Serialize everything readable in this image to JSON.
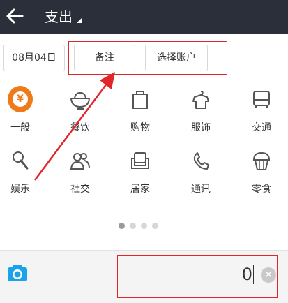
{
  "header": {
    "title": "支出"
  },
  "toolbar": {
    "date": "08月04日",
    "note": "备注",
    "account": "选择账户"
  },
  "categories": [
    {
      "label": "一般",
      "icon": "yen-circle-icon"
    },
    {
      "label": "餐饮",
      "icon": "rice-bowl-icon"
    },
    {
      "label": "购物",
      "icon": "shopping-bag-icon"
    },
    {
      "label": "服饰",
      "icon": "shirt-hanger-icon"
    },
    {
      "label": "交通",
      "icon": "bus-icon"
    },
    {
      "label": "娱乐",
      "icon": "microphone-icon"
    },
    {
      "label": "社交",
      "icon": "people-icon"
    },
    {
      "label": "居家",
      "icon": "sofa-icon"
    },
    {
      "label": "通讯",
      "icon": "phone-icon"
    },
    {
      "label": "零食",
      "icon": "cupcake-icon"
    }
  ],
  "pager": {
    "pages": 4,
    "active": 1
  },
  "input": {
    "amount": "0"
  },
  "colors": {
    "topbar": "#2b2f3a",
    "accent": "#f07a1a",
    "camera": "#1aa3e8",
    "annotation": "#e0262a"
  }
}
